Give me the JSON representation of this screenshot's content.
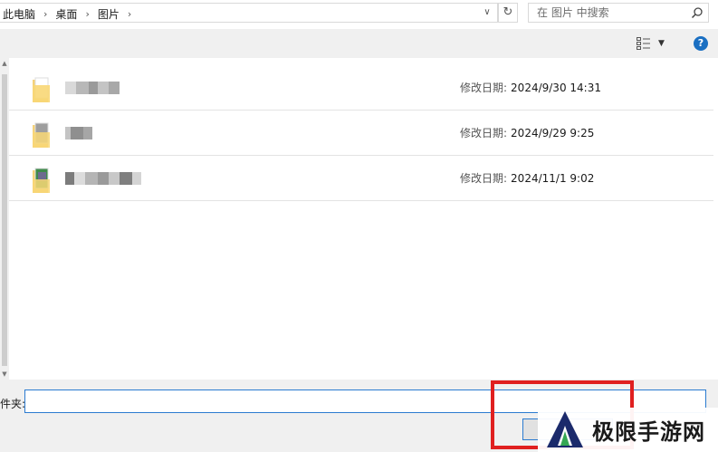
{
  "address_bar": {
    "breadcrumbs": [
      "此电脑",
      "桌面",
      "图片"
    ]
  },
  "search": {
    "placeholder": "在 图片 中搜索"
  },
  "toolbar": {
    "help_glyph": "?"
  },
  "files": [
    {
      "modified_label": "修改日期:",
      "modified": "2024/9/30 14:31"
    },
    {
      "modified_label": "修改日期:",
      "modified": "2024/9/29 9:25"
    },
    {
      "modified_label": "修改日期:",
      "modified": "2024/11/1 9:02"
    }
  ],
  "footer": {
    "folder_label": "件夹:",
    "folder_value": ""
  },
  "watermark": {
    "text": "极限手游网"
  },
  "colors": {
    "accent": "#2b7bd0",
    "help": "#1a6fc2",
    "annotation": "#e02020"
  }
}
